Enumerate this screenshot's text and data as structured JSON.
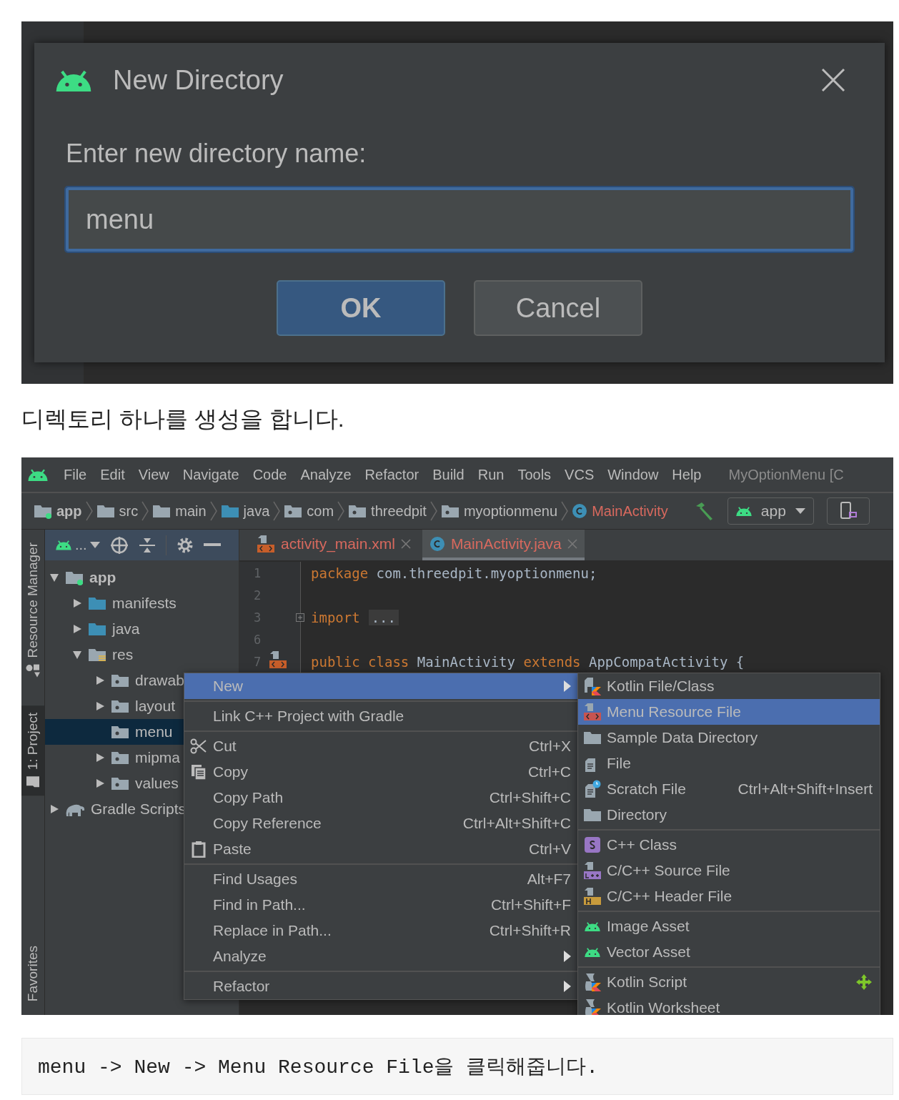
{
  "dialog_screenshot": {
    "title": "New Directory",
    "prompt": "Enter new directory name:",
    "field": {
      "value": "menu"
    },
    "buttons": [
      {
        "label": "OK",
        "default": true
      },
      {
        "label": "Cancel",
        "default": false
      }
    ]
  },
  "caption": "디렉토리 하나를 생성을 합니다.",
  "ide_screenshot": {
    "menu_bar": [
      "File",
      "Edit",
      "View",
      "Navigate",
      "Code",
      "Analyze",
      "Refactor",
      "Build",
      "Run",
      "Tools",
      "VCS",
      "Window",
      "Help"
    ],
    "project_title": "MyOptionMenu [C",
    "breadcrumbs": [
      {
        "label": "app",
        "kind": "module"
      },
      {
        "label": "src",
        "kind": "folder"
      },
      {
        "label": "main",
        "kind": "folder"
      },
      {
        "label": "java",
        "kind": "source"
      },
      {
        "label": "com",
        "kind": "package"
      },
      {
        "label": "threedpit",
        "kind": "package"
      },
      {
        "label": "myoptionmenu",
        "kind": "package"
      },
      {
        "label": "MainActivity",
        "kind": "class"
      }
    ],
    "run_config": "app",
    "side_tabs": [
      {
        "label": "Resource Manager",
        "selected": false
      },
      {
        "label": "1: Project",
        "selected": true
      },
      {
        "label": "Favorites",
        "selected": false
      }
    ],
    "view_selector": "...",
    "tree": [
      {
        "label": "app",
        "kind": "module",
        "expanded": true,
        "selected": false,
        "children": [
          {
            "label": "manifests",
            "kind": "source",
            "expanded": false,
            "selected": false
          },
          {
            "label": "java",
            "kind": "source",
            "expanded": false,
            "selected": false
          },
          {
            "label": "res",
            "kind": "resources",
            "expanded": true,
            "selected": false,
            "children": [
              {
                "label": "drawab",
                "kind": "package",
                "expanded": false,
                "selected": false
              },
              {
                "label": "layout",
                "kind": "package",
                "expanded": false,
                "selected": false
              },
              {
                "label": "menu",
                "kind": "package",
                "selected": true
              },
              {
                "label": "mipma",
                "kind": "package",
                "expanded": false,
                "selected": false
              },
              {
                "label": "values",
                "kind": "package",
                "expanded": false,
                "selected": false
              }
            ]
          }
        ]
      },
      {
        "label": "Gradle Scripts",
        "kind": "gradle",
        "expanded": false,
        "selected": false
      }
    ],
    "editor_tabs": [
      {
        "label": "activity_main.xml",
        "kind": "xml",
        "selected": false
      },
      {
        "label": "MainActivity.java",
        "kind": "class",
        "selected": true
      }
    ],
    "code_lines": [
      {
        "number": "1",
        "kind": "plain",
        "tokens": [
          {
            "kind": "keyword",
            "text": "package"
          },
          {
            "kind": "plain",
            "text": " com.threedpit.myoptionmenu;"
          }
        ]
      },
      {
        "number": "2",
        "kind": "plain"
      },
      {
        "number": "3",
        "kind": "fold",
        "tokens": [
          {
            "kind": "keyword",
            "text": "import"
          },
          {
            "kind": "folded",
            "text": "..."
          }
        ]
      },
      {
        "number": "6",
        "kind": "plain"
      },
      {
        "number": "7",
        "kind": "xml",
        "tokens": [
          {
            "kind": "keyword",
            "text": "public class"
          },
          {
            "kind": "plain",
            "text": " MainActivity "
          },
          {
            "kind": "keyword",
            "text": "extends"
          },
          {
            "kind": "plain",
            "text": " AppCompatActivity {"
          }
        ]
      }
    ],
    "context_menu": [
      [
        {
          "label": "New",
          "kind": "plain",
          "submenu": true,
          "selected": true
        }
      ],
      [
        {
          "label": "Link C++ Project with Gradle",
          "kind": "plain",
          "submenu": false,
          "selected": false
        }
      ],
      [
        {
          "label": "Cut",
          "kind": "cut",
          "shortcut": "Ctrl+X",
          "submenu": false,
          "selected": false
        },
        {
          "label": "Copy",
          "kind": "copy",
          "shortcut": "Ctrl+C",
          "submenu": false,
          "selected": false
        },
        {
          "label": "Copy Path",
          "kind": "plain",
          "shortcut": "Ctrl+Shift+C",
          "submenu": false,
          "selected": false
        },
        {
          "label": "Copy Reference",
          "kind": "plain",
          "shortcut": "Ctrl+Alt+Shift+C",
          "submenu": false,
          "selected": false
        },
        {
          "label": "Paste",
          "kind": "paste",
          "shortcut": "Ctrl+V",
          "submenu": false,
          "selected": false
        }
      ],
      [
        {
          "label": "Find Usages",
          "kind": "plain",
          "shortcut": "Alt+F7",
          "submenu": false,
          "selected": false
        },
        {
          "label": "Find in Path...",
          "kind": "plain",
          "shortcut": "Ctrl+Shift+F",
          "submenu": false,
          "selected": false
        },
        {
          "label": "Replace in Path...",
          "kind": "plain",
          "shortcut": "Ctrl+Shift+R",
          "submenu": false,
          "selected": false
        },
        {
          "label": "Analyze",
          "kind": "plain",
          "submenu": true,
          "selected": false
        }
      ],
      [
        {
          "label": "Refactor",
          "kind": "plain",
          "submenu": true,
          "selected": false
        }
      ]
    ],
    "submenu": [
      [
        {
          "label": "Kotlin File/Class",
          "kind": "kotlin",
          "selected": false
        },
        {
          "label": "Menu Resource File",
          "kind": "xml",
          "selected": true
        },
        {
          "label": "Sample Data Directory",
          "kind": "folder",
          "selected": false
        },
        {
          "label": "File",
          "kind": "file",
          "selected": false
        },
        {
          "label": "Scratch File",
          "kind": "scratch",
          "shortcut": "Ctrl+Alt+Shift+Insert",
          "selected": false
        },
        {
          "label": "Directory",
          "kind": "folder",
          "selected": false
        }
      ],
      [
        {
          "label": "C++ Class",
          "kind": "cpp-class",
          "selected": false
        },
        {
          "label": "C/C++ Source File",
          "kind": "cpp-source",
          "selected": false
        },
        {
          "label": "C/C++ Header File",
          "kind": "cpp-header",
          "selected": false
        }
      ],
      [
        {
          "label": "Image Asset",
          "kind": "android",
          "selected": false
        },
        {
          "label": "Vector Asset",
          "kind": "android",
          "selected": false
        }
      ],
      [
        {
          "label": "Kotlin Script",
          "kind": "kotlin-script",
          "selected": false
        },
        {
          "label": "Kotlin Worksheet",
          "kind": "kotlin-script",
          "selected": false
        }
      ]
    ]
  },
  "instruction": "menu -> New -> Menu Resource File을 클릭해줍니다."
}
